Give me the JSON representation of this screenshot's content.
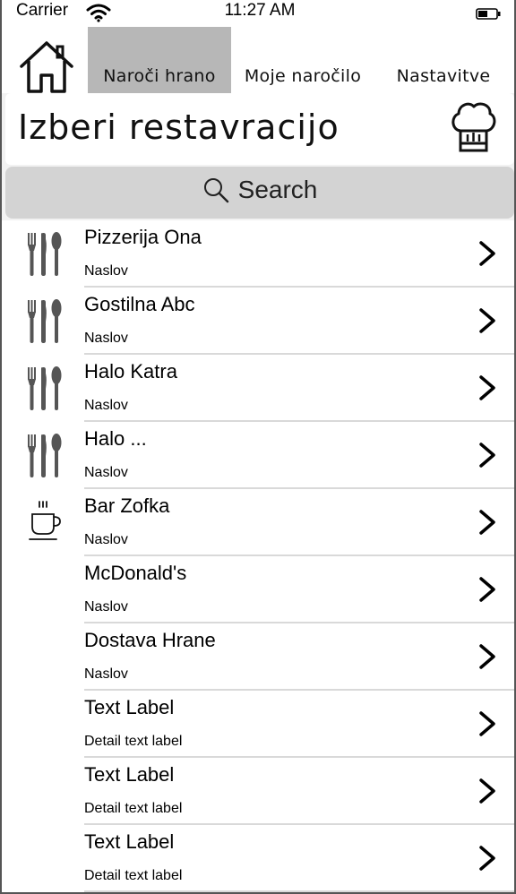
{
  "status_bar": {
    "carrier": "Carrier",
    "time": "11:27 AM"
  },
  "tabs": [
    {
      "label": "Naroči hrano",
      "active": true
    },
    {
      "label": "Moje naročilo",
      "active": false
    },
    {
      "label": "Nastavitve",
      "active": false
    }
  ],
  "header": {
    "title": "Izberi restavracijo"
  },
  "search": {
    "placeholder": "Search"
  },
  "restaurants": [
    {
      "label": "Pizzerija Ona",
      "detail": "Naslov",
      "icon": "cutlery-icon"
    },
    {
      "label": "Gostilna Abc",
      "detail": "Naslov",
      "icon": "cutlery-icon"
    },
    {
      "label": "Halo Katra",
      "detail": "Naslov",
      "icon": "cutlery-icon"
    },
    {
      "label": "Halo ...",
      "detail": "Naslov",
      "icon": "cutlery-icon"
    },
    {
      "label": "Bar Zofka",
      "detail": "Naslov",
      "icon": "coffee-cup-icon"
    },
    {
      "label": "McDonald's",
      "detail": "Naslov",
      "icon": ""
    },
    {
      "label": "Dostava Hrane",
      "detail": "Naslov",
      "icon": ""
    },
    {
      "label": "Text Label",
      "detail": "Detail text label",
      "icon": ""
    },
    {
      "label": "Text Label",
      "detail": "Detail text label",
      "icon": ""
    },
    {
      "label": "Text Label",
      "detail": "Detail text label",
      "icon": ""
    }
  ],
  "colors": {
    "active_tab": "#b7b7b7",
    "search_bg": "#d3d3d3",
    "icon_gray": "#555555"
  }
}
